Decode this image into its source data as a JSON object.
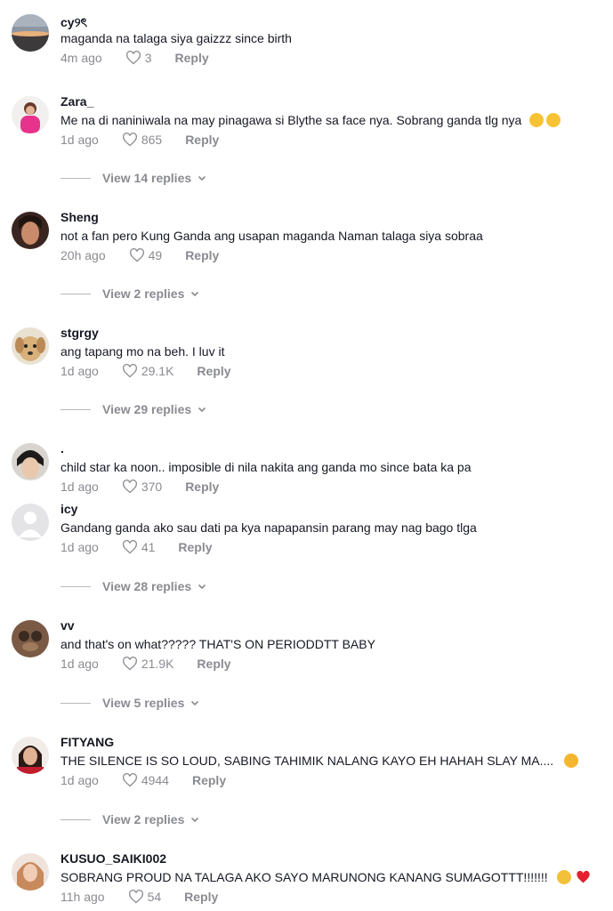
{
  "comments": [
    {
      "username": "cy୨ৎ",
      "text": "maganda na talaga siya gaizzz since birth",
      "time": "4m ago",
      "likes": "3",
      "reply": "Reply",
      "replies": ""
    },
    {
      "username": "Zara_",
      "text": "Me na di naniniwala na may pinagawa si Blythe sa face nya. Sobrang ganda tlg nya",
      "time": "1d ago",
      "likes": "865",
      "reply": "Reply",
      "replies": "View 14 replies"
    },
    {
      "username": "Sheng",
      "text": "not a fan pero Kung Ganda ang usapan maganda Naman talaga siya sobraa",
      "time": "20h ago",
      "likes": "49",
      "reply": "Reply",
      "replies": "View 2 replies"
    },
    {
      "username": "stgrgy",
      "text": "ang tapang mo na beh. I luv it",
      "time": "1d ago",
      "likes": "29.1K",
      "reply": "Reply",
      "replies": "View 29 replies"
    },
    {
      "username": ".",
      "text": "child star ka noon.. imposible di nila nakita ang ganda mo since bata ka pa",
      "time": "1d ago",
      "likes": "370",
      "reply": "Reply",
      "replies": ""
    },
    {
      "username": "icy",
      "text": "Gandang ganda ako sau dati pa kya napapansin parang may nag bago tlga",
      "time": "1d ago",
      "likes": "41",
      "reply": "Reply",
      "replies": "View 28 replies"
    },
    {
      "username": "vv",
      "text": "and that's on what????? THAT'S ON PERIODDTT BABY",
      "time": "1d ago",
      "likes": "21.9K",
      "reply": "Reply",
      "replies": "View 5 replies"
    },
    {
      "username": "FITYANG",
      "text": "THE SILENCE IS SO LOUD, SABING TAHIMIK NALANG KAYO EH HAHAH SLAY MA....",
      "time": "1d ago",
      "likes": "4944",
      "reply": "Reply",
      "replies": "View 2 replies"
    },
    {
      "username": "KUSUO_SAIKI002",
      "text": "SOBRANG PROUD NA TALAGA AKO SAYO MARUNONG KANANG SUMAGOTTT!!!!!!!",
      "time": "11h ago",
      "likes": "54",
      "reply": "Reply",
      "replies": ""
    }
  ],
  "icons": {
    "like": "heart-outline-icon",
    "expand": "chevron-down-icon"
  },
  "colors": {
    "text": "#161823",
    "muted": "#8a8b91"
  }
}
